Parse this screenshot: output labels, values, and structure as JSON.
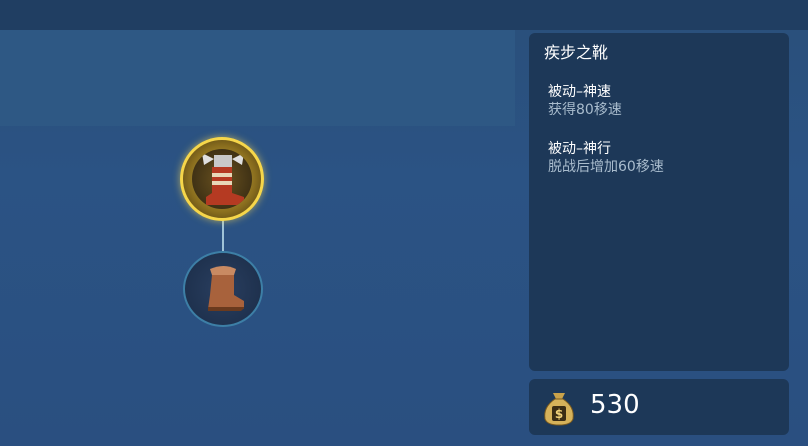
{
  "item": {
    "name": "疾步之靴",
    "top_node_icon": "hermes-boots-icon",
    "bottom_node_icon": "leather-boots-icon"
  },
  "skills": [
    {
      "name": "被动–神速",
      "desc": "获得80移速"
    },
    {
      "name": "被动–神行",
      "desc": "脱战后增加60移速"
    }
  ],
  "gold": {
    "icon": "money-bag-icon",
    "value": "530"
  },
  "colors": {
    "panel": "#1d3858",
    "highlight_ring": "#f6d64a",
    "desc_text": "#a9bccd"
  }
}
